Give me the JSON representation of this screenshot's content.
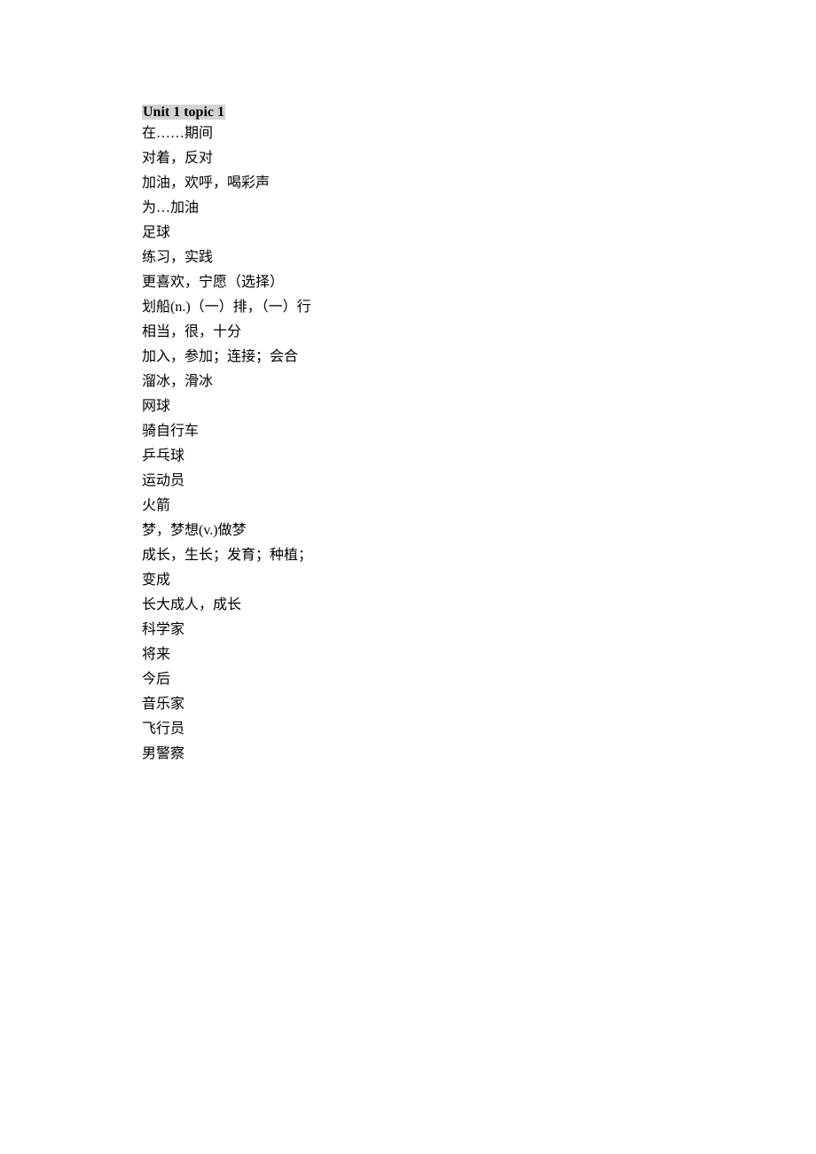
{
  "heading": "Unit 1 topic 1",
  "lines": [
    "在……期间",
    "对着，反对",
    "加油，欢呼，喝彩声",
    "为…加油",
    "足球",
    "练习，实践",
    "更喜欢，宁愿（选择）",
    "划船(n.)（一）排，（一）行",
    "相当，很，十分",
    "加入，参加；连接；会合",
    "溜冰，滑冰",
    "网球",
    "骑自行车",
    "乒乓球",
    "运动员",
    "火箭",
    "梦，梦想(v.)做梦",
    "成长，生长；发育；种植；",
    "变成",
    "长大成人，成长",
    "科学家",
    "将来",
    "今后",
    "音乐家",
    "飞行员",
    "男警察"
  ]
}
